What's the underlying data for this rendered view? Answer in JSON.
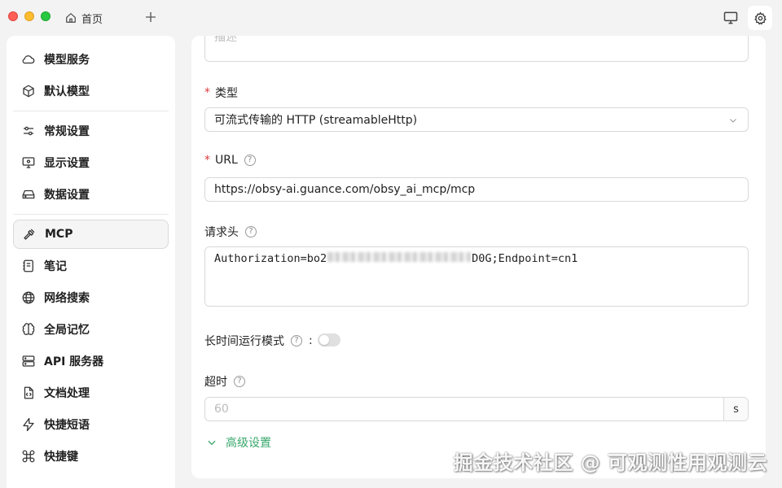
{
  "titlebar": {
    "tab_home_label": "首页"
  },
  "sidebar": {
    "groups": [
      [
        {
          "label": "模型服务",
          "icon": "cloud-icon"
        },
        {
          "label": "默认模型",
          "icon": "cube-icon"
        }
      ],
      [
        {
          "label": "常规设置",
          "icon": "sliders-icon"
        },
        {
          "label": "显示设置",
          "icon": "monitor-settings-icon"
        },
        {
          "label": "数据设置",
          "icon": "hard-drive-icon"
        }
      ],
      [
        {
          "label": "MCP",
          "icon": "hammer-icon"
        },
        {
          "label": "笔记",
          "icon": "notebook-icon"
        },
        {
          "label": "网络搜索",
          "icon": "globe-icon"
        },
        {
          "label": "全局记忆",
          "icon": "brain-icon"
        },
        {
          "label": "API 服务器",
          "icon": "server-icon"
        },
        {
          "label": "文档处理",
          "icon": "file-code-icon"
        },
        {
          "label": "快捷短语",
          "icon": "zap-icon"
        },
        {
          "label": "快捷键",
          "icon": "command-icon"
        }
      ]
    ],
    "active": "MCP"
  },
  "form": {
    "top_placeholder": "描述",
    "type_label": "类型",
    "type_value": "可流式传输的 HTTP (streamableHttp)",
    "url_label": "URL",
    "url_value": "https://obsy-ai.guance.com/obsy_ai_mcp/mcp",
    "headers_label": "请求头",
    "headers_prefix": "Authorization=bo2",
    "headers_suffix": "D0G;Endpoint=cn1",
    "long_running_label": "长时间运行模式",
    "long_running_colon": ":",
    "long_running_enabled": false,
    "timeout_label": "超时",
    "timeout_placeholder": "60",
    "timeout_unit": "s",
    "advanced_label": "高级设置"
  },
  "watermark": "掘金技术社区 @ 可观测性用观测云",
  "colors": {
    "accent_green": "#3aa76d",
    "required_red": "#e0393e"
  }
}
